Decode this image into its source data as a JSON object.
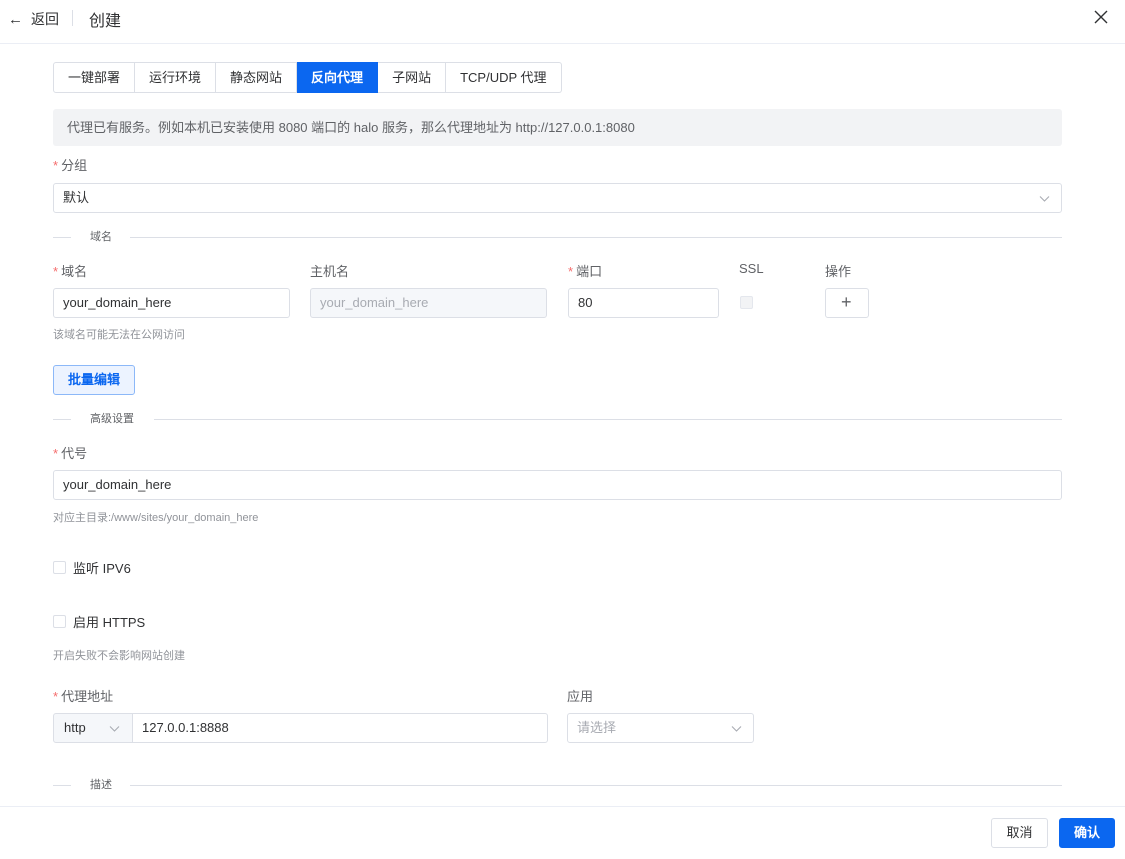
{
  "header": {
    "back_label": "返回",
    "title": "创建"
  },
  "tabs": [
    {
      "label": "一键部署",
      "active": false
    },
    {
      "label": "运行环境",
      "active": false
    },
    {
      "label": "静态网站",
      "active": false
    },
    {
      "label": "反向代理",
      "active": true
    },
    {
      "label": "子网站",
      "active": false
    },
    {
      "label": "TCP/UDP 代理",
      "active": false
    }
  ],
  "notice": "代理已有服务。例如本机已安装使用 8080 端口的 halo 服务，那么代理地址为 http://127.0.0.1:8080",
  "group": {
    "label": "分组",
    "value": "默认"
  },
  "domain_section": {
    "title": "域名",
    "domain_label": "域名",
    "hostname_label": "主机名",
    "port_label": "端口",
    "ssl_label": "SSL",
    "action_label": "操作",
    "domain_value": "your_domain_here",
    "hostname_value": "your_domain_here",
    "port_value": "80",
    "ssl_checked": false,
    "domain_hint": "该域名可能无法在公网访问",
    "add_symbol": "+",
    "batch_edit_label": "批量编辑"
  },
  "advanced_section": {
    "title": "高级设置",
    "alias_label": "代号",
    "alias_value": "your_domain_here",
    "alias_hint": "对应主目录:/www/sites/your_domain_here",
    "ipv6_label": "监听 IPV6",
    "ipv6_checked": false,
    "https_label": "启用 HTTPS",
    "https_checked": false,
    "https_hint": "开启失败不会影响网站创建"
  },
  "proxy": {
    "label": "代理地址",
    "protocol": "http",
    "address": "127.0.0.1:8888",
    "app_label": "应用",
    "app_placeholder": "请选择"
  },
  "description_section": {
    "title": "描述"
  },
  "footer": {
    "cancel_label": "取消",
    "confirm_label": "确认"
  },
  "colors": {
    "primary": "#0b67f0",
    "required": "#f56c6c",
    "border": "#dcdfe6"
  }
}
